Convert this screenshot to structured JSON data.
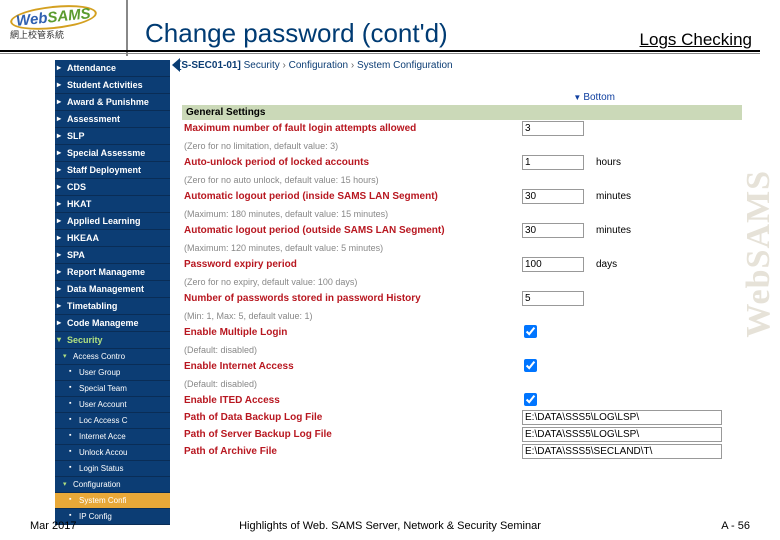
{
  "logo": {
    "text1": "Web",
    "text2": "SAMS",
    "sub": "網上校管系統"
  },
  "title": "Change password (cont'd)",
  "logs_label": "Logs Checking",
  "breadcrumb": {
    "code": "[S-SEC01-01]",
    "path": [
      "Security",
      "Configuration",
      "System Configuration"
    ]
  },
  "bottom_link": "Bottom",
  "sidebar": [
    {
      "label": "Attendance",
      "t": "i"
    },
    {
      "label": "Student Activities",
      "t": "i"
    },
    {
      "label": "Award & Punishme",
      "t": "i"
    },
    {
      "label": "Assessment",
      "t": "i"
    },
    {
      "label": "SLP",
      "t": "i"
    },
    {
      "label": "Special Assessme",
      "t": "i"
    },
    {
      "label": "Staff Deployment",
      "t": "i"
    },
    {
      "label": "CDS",
      "t": "i"
    },
    {
      "label": "HKAT",
      "t": "i"
    },
    {
      "label": "Applied Learning",
      "t": "i"
    },
    {
      "label": "HKEAA",
      "t": "i"
    },
    {
      "label": "SPA",
      "t": "i"
    },
    {
      "label": "Report Manageme",
      "t": "i"
    },
    {
      "label": "Data Management",
      "t": "i"
    },
    {
      "label": "Timetabling",
      "t": "i"
    },
    {
      "label": "Code Manageme",
      "t": "i"
    },
    {
      "label": "Security",
      "t": "o",
      "cls": "sec"
    },
    {
      "label": "Access Contro",
      "t": "so"
    },
    {
      "label": "User Group",
      "t": "s2"
    },
    {
      "label": "Special Team",
      "t": "s2"
    },
    {
      "label": "User Account",
      "t": "s2"
    },
    {
      "label": "Loc Access C",
      "t": "s2"
    },
    {
      "label": "Internet Acce",
      "t": "s2"
    },
    {
      "label": "Unlock Accou",
      "t": "s2"
    },
    {
      "label": "Login Status",
      "t": "s2"
    },
    {
      "label": "Configuration",
      "t": "so"
    },
    {
      "label": "System Confi",
      "t": "s2",
      "cls": "active"
    },
    {
      "label": "IP Config",
      "t": "s2"
    }
  ],
  "section": "General Settings",
  "rows": [
    {
      "lbl": "Maximum number of fault login attempts allowed",
      "val": "3",
      "hint": "(Zero for no limitation, default value: 3)"
    },
    {
      "lbl": "Auto-unlock period of locked accounts",
      "val": "1",
      "unit": "hours",
      "hint": "(Zero for no auto unlock, default value: 15 hours)"
    },
    {
      "lbl": "Automatic logout period (inside SAMS LAN Segment)",
      "val": "30",
      "unit": "minutes",
      "hint": "(Maximum: 180 minutes, default value: 15 minutes)"
    },
    {
      "lbl": "Automatic logout period (outside SAMS LAN Segment)",
      "val": "30",
      "unit": "minutes",
      "hint": "(Maximum: 120 minutes, default value: 5 minutes)"
    },
    {
      "lbl": "Password expiry period",
      "val": "100",
      "unit": "days",
      "hint": "(Zero for no expiry, default value: 100 days)"
    },
    {
      "lbl": "Number of passwords stored in password History",
      "val": "5",
      "hint": "(Min: 1, Max: 5, default value: 1)"
    },
    {
      "lbl": "Enable Multiple Login",
      "cb": true,
      "checked": true,
      "hint": "(Default: disabled)"
    },
    {
      "lbl": "Enable Internet Access",
      "cb": true,
      "checked": true,
      "hint": "(Default: disabled)"
    },
    {
      "lbl": "Enable ITED Access",
      "cb": true,
      "checked": true
    },
    {
      "lbl": "Path of Data Backup Log File",
      "wide": "E:\\DATA\\SSS5\\LOG\\LSP\\"
    },
    {
      "lbl": "Path of Server Backup Log File",
      "wide": "E:\\DATA\\SSS5\\LOG\\LSP\\"
    },
    {
      "lbl": "Path of Archive File",
      "wide": "E:\\DATA\\SSS5\\SECLAND\\T\\"
    }
  ],
  "footer": {
    "date": "Mar 2017",
    "title": "Highlights of Web. SAMS Server, Network & Security Seminar",
    "page": "A - 56"
  },
  "watermark": "WebSAMS"
}
